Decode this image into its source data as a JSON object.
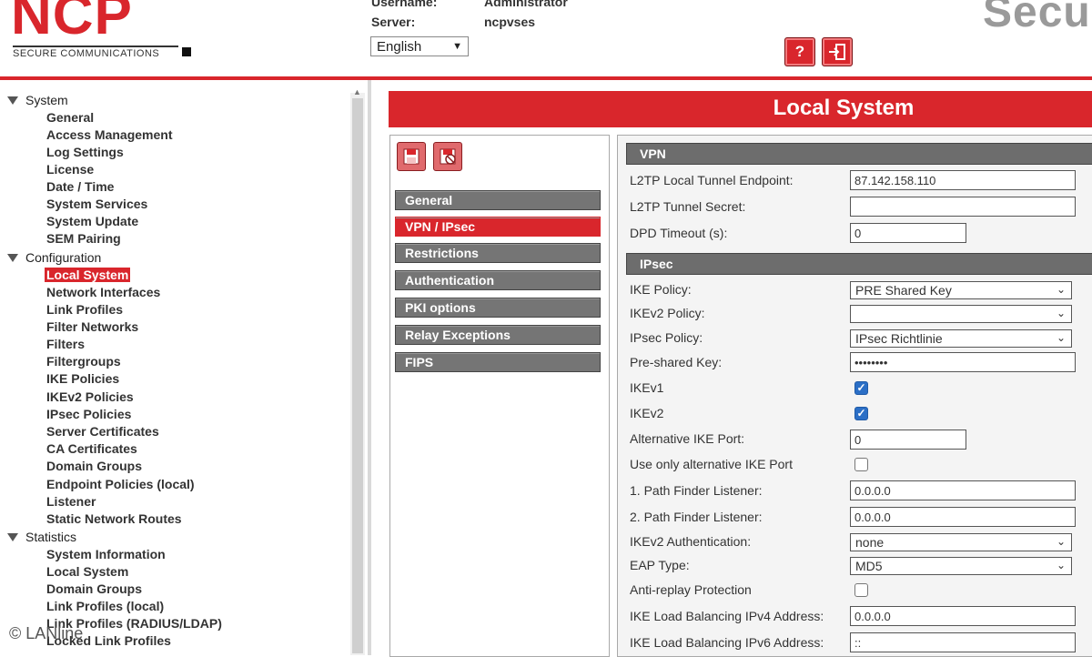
{
  "header": {
    "logo_text": "NCP",
    "logo_sub": "SECURE COMMUNICATIONS",
    "username_label": "Username:",
    "username_value": "Administrator",
    "server_label": "Server:",
    "server_value": "ncpvses",
    "language": "English",
    "brand_right": "Secu",
    "help_icon": "help-icon",
    "logout_icon": "logout-icon",
    "accent_color": "#d9262c"
  },
  "sidebar": {
    "groups": [
      {
        "label": "System",
        "items": [
          "General",
          "Access Management",
          "Log Settings",
          "License",
          "Date / Time",
          "System Services",
          "System Update",
          "SEM Pairing"
        ]
      },
      {
        "label": "Configuration",
        "items": [
          "Local System",
          "Network Interfaces",
          "Link Profiles",
          "Filter Networks",
          "Filters",
          "Filtergroups",
          "IKE Policies",
          "IKEv2 Policies",
          "IPsec Policies",
          "Server Certificates",
          "CA Certificates",
          "Domain Groups",
          "Endpoint Policies (local)",
          "Listener",
          "Static Network Routes"
        ]
      },
      {
        "label": "Statistics",
        "items": [
          "System Information",
          "Local System",
          "Domain Groups",
          "Link Profiles (local)",
          "Link Profiles (RADIUS/LDAP)",
          "Locked Link Profiles"
        ]
      }
    ],
    "active_item": "Local System"
  },
  "main": {
    "title": "Local System",
    "tabs": [
      "General",
      "VPN / IPsec",
      "Restrictions",
      "Authentication",
      "PKI options",
      "Relay Exceptions",
      "FIPS"
    ],
    "active_tab": "VPN / IPsec",
    "vpn_section": "VPN",
    "ipsec_section": "IPsec",
    "vpn": {
      "l2tp_endpoint_label": "L2TP Local Tunnel Endpoint:",
      "l2tp_endpoint_value": "87.142.158.110",
      "l2tp_secret_label": "L2TP Tunnel Secret:",
      "l2tp_secret_value": "",
      "dpd_label": "DPD Timeout (s):",
      "dpd_value": "0"
    },
    "ipsec": {
      "ike_policy_label": "IKE Policy:",
      "ike_policy_value": "PRE Shared Key",
      "ikev2_policy_label": "IKEv2 Policy:",
      "ikev2_policy_value": "",
      "ipsec_policy_label": "IPsec Policy:",
      "ipsec_policy_value": "IPsec Richtlinie",
      "psk_label": "Pre-shared Key:",
      "psk_value": "••••••••",
      "ikev1_label": "IKEv1",
      "ikev1_checked": true,
      "ikev2_label": "IKEv2",
      "ikev2_checked": true,
      "alt_port_label": "Alternative IKE Port:",
      "alt_port_value": "0",
      "use_alt_label": "Use only alternative IKE Port",
      "use_alt_checked": false,
      "pf1_label": "1. Path Finder Listener:",
      "pf1_value": "0.0.0.0",
      "pf2_label": "2. Path Finder Listener:",
      "pf2_value": "0.0.0.0",
      "ikev2_auth_label": "IKEv2 Authentication:",
      "ikev2_auth_value": "none",
      "eap_label": "EAP Type:",
      "eap_value": "MD5",
      "antireplay_label": "Anti-replay Protection",
      "antireplay_checked": false,
      "lb4_label": "IKE Load Balancing IPv4 Address:",
      "lb4_value": "0.0.0.0",
      "lb6_label": "IKE Load Balancing IPv6 Address:",
      "lb6_value": "::"
    }
  },
  "watermark": "© LANline"
}
